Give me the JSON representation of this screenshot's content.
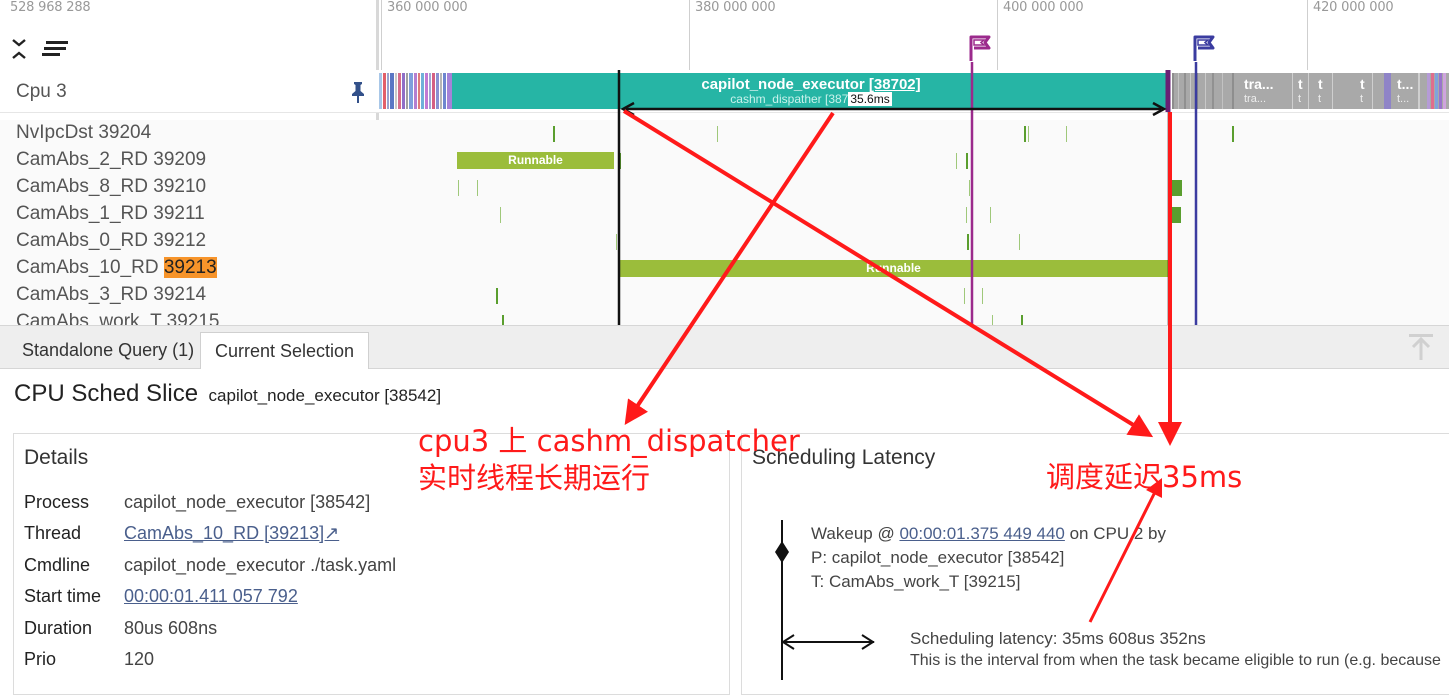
{
  "timeline": {
    "offset_label": "528 968 288",
    "ticks": [
      "360 000 000",
      "380 000 000",
      "400 000 000",
      "420 000 000"
    ]
  },
  "cpu_track": {
    "label": "Cpu 3",
    "slice_title_prefix": "capilot_node_executor ",
    "slice_title_pid": "[38702]",
    "slice_subtitle": "cashm_dispather [387",
    "measure_label": "35.6ms",
    "right_slice_labels": [
      "tra...",
      "t",
      "t",
      "t",
      "t..."
    ],
    "right_slice_sub": [
      "tra...",
      "t",
      "t",
      "t",
      "t..."
    ],
    "colors": {
      "slice": "#26b5a5",
      "flag_purple": "#9b2a8c",
      "flag_blue": "#3b3ca0"
    }
  },
  "threads": [
    {
      "name": "NvIpcDst 39204"
    },
    {
      "name": "CamAbs_2_RD 39209",
      "runnable_label": "Runnable"
    },
    {
      "name": "CamAbs_8_RD 39210"
    },
    {
      "name": "CamAbs_1_RD 39211"
    },
    {
      "name": "CamAbs_0_RD 39212"
    },
    {
      "name_prefix": "CamAbs_10_RD ",
      "name_highlight": "39213",
      "runnable_label": "Runnable"
    },
    {
      "name": "CamAbs_3_RD 39214"
    },
    {
      "name": "CamAbs_work_T 39215"
    }
  ],
  "tabs": [
    "Standalone Query (1)",
    "Current Selection"
  ],
  "panel": {
    "title": "CPU Sched Slice",
    "subtitle": "capilot_node_executor [38542]"
  },
  "details": {
    "title": "Details",
    "rows": [
      {
        "label": "Process",
        "value": "capilot_node_executor [38542]"
      },
      {
        "label": "Thread",
        "value": "CamAbs_10_RD [39213]↗"
      },
      {
        "label": "Cmdline",
        "value": "capilot_node_executor ./task.yaml"
      },
      {
        "label": "Start time",
        "value": "00:00:01.411 057 792"
      },
      {
        "label": "Duration",
        "value": "80us 608ns"
      },
      {
        "label": "Prio",
        "value": "120"
      }
    ]
  },
  "latency": {
    "title": "Scheduling Latency",
    "wakeup_prefix": "Wakeup @ ",
    "wakeup_time": "00:00:01.375 449 440",
    "wakeup_suffix": " on CPU 2 by",
    "process": "P: capilot_node_executor [38542]",
    "thread": "T: CamAbs_work_T [39215]",
    "latency": "Scheduling latency: 35ms 608us 352ns",
    "description": "This is the interval from when the task became eligible to run (e.g. because"
  },
  "annotations": {
    "line1": "cpu3 上 cashm_dispatcher",
    "line2": "实时线程长期运行",
    "delay": "调度延迟35ms",
    "color": "#ff1a1a"
  }
}
